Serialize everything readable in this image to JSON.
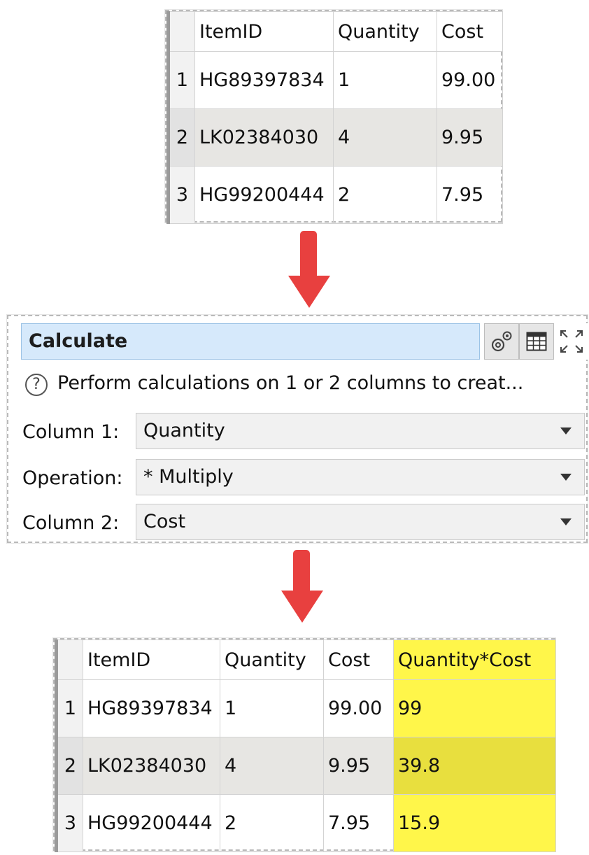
{
  "input_table": {
    "headers": [
      "ItemID",
      "Quantity",
      "Cost"
    ],
    "rows": [
      {
        "num": "1",
        "cells": [
          "HG89397834",
          "1",
          "99.00"
        ]
      },
      {
        "num": "2",
        "cells": [
          "LK02384030",
          "4",
          "9.95"
        ]
      },
      {
        "num": "3",
        "cells": [
          "HG99200444",
          "2",
          "7.95"
        ]
      }
    ]
  },
  "calculate": {
    "title": "Calculate",
    "help_text": "Perform calculations on 1 or 2 columns to creat...",
    "help_icon": "?",
    "fields": [
      {
        "label": "Column 1:",
        "value": "Quantity"
      },
      {
        "label": "Operation:",
        "value": "* Multiply"
      },
      {
        "label": "Column 2:",
        "value": "Cost"
      }
    ],
    "icons": [
      "gears-icon",
      "table-icon",
      "maximize-icon"
    ]
  },
  "output_table": {
    "headers": [
      "ItemID",
      "Quantity",
      "Cost",
      "Quantity*Cost"
    ],
    "rows": [
      {
        "num": "1",
        "cells": [
          "HG89397834",
          "1",
          "99.00",
          "99"
        ]
      },
      {
        "num": "2",
        "cells": [
          "LK02384030",
          "4",
          "9.95",
          "39.8"
        ]
      },
      {
        "num": "3",
        "cells": [
          "HG99200444",
          "2",
          "7.95",
          "15.9"
        ]
      }
    ]
  },
  "colors": {
    "arrow": "#e8403f",
    "highlight": "#fff64a",
    "title_bg": "#d6e9fb"
  }
}
